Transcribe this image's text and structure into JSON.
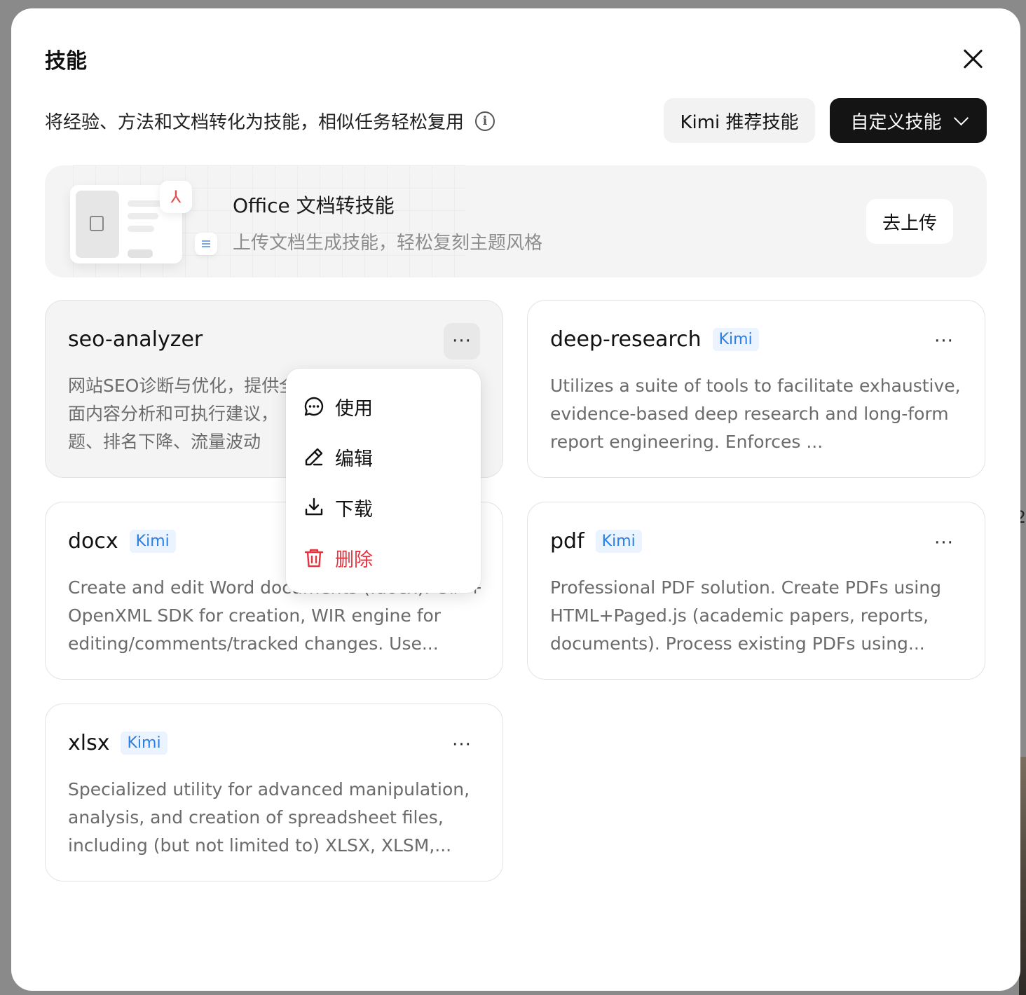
{
  "dialog": {
    "title": "技能",
    "subtitle": "将经验、方法和文档转化为技能，相似任务轻松复用",
    "kimi_button": "Kimi 推荐技能",
    "custom_button": "自定义技能"
  },
  "banner": {
    "title": "Office 文档转技能",
    "description": "上传文档生成技能，轻松复刻主题风格",
    "upload_button": "去上传"
  },
  "tag_label": "Kimi",
  "more_label": "···",
  "skills": [
    {
      "name": "seo-analyzer",
      "tag": "",
      "description": "网站SEO诊断与优化，提供全\n面内容分析和可执行建议，\n题、排名下降、流量波动"
    },
    {
      "name": "deep-research",
      "tag": "Kimi",
      "description": "Utilizes a suite of tools to facilitate exhaustive, evidence-based deep research and long-form report engineering. Enforces ..."
    },
    {
      "name": "docx",
      "tag": "Kimi",
      "description": "Create and edit Word documents (.docx). C# + OpenXML SDK for creation, WIR engine for editing/comments/tracked changes. Use..."
    },
    {
      "name": "pdf",
      "tag": "Kimi",
      "description": "Professional PDF solution. Create PDFs using HTML+Paged.js (academic papers, reports, documents). Process existing PDFs using..."
    },
    {
      "name": "xlsx",
      "tag": "Kimi",
      "description": "Specialized utility for advanced manipulation, analysis, and creation of spreadsheet files, including (but not limited to) XLSX, XLSM,..."
    }
  ],
  "context_menu": {
    "items": [
      {
        "label": "使用",
        "icon": "chat-icon"
      },
      {
        "label": "编辑",
        "icon": "pencil-icon"
      },
      {
        "label": "下载",
        "icon": "download-icon"
      },
      {
        "label": "删除",
        "icon": "trash-icon"
      }
    ]
  },
  "colors": {
    "accent_dark": "#141414",
    "tag_blue": "#2b7fe0",
    "danger": "#e8343f"
  }
}
